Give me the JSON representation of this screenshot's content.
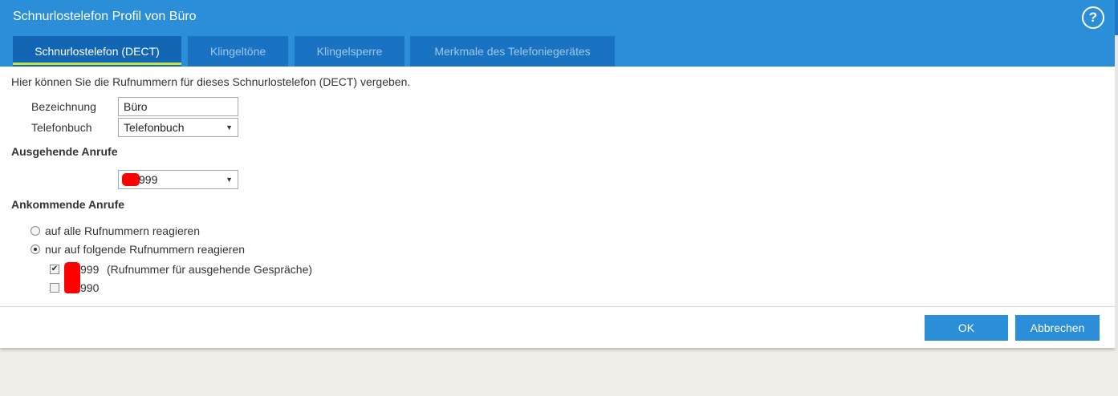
{
  "dialog": {
    "title": "Schnurlostelefon Profil von Büro",
    "help_icon": "help-icon"
  },
  "tabs": [
    {
      "label": "Schnurlostelefon (DECT)",
      "active": true
    },
    {
      "label": "Klingeltöne",
      "active": false
    },
    {
      "label": "Klingelsperre",
      "active": false
    },
    {
      "label": "Merkmale des Telefoniegerätes",
      "active": false
    }
  ],
  "intro": "Hier können Sie die Rufnummern für dieses Schnurlostelefon (DECT) vergeben.",
  "form": {
    "bezeichnung_label": "Bezeichnung",
    "bezeichnung_value": "Büro",
    "telefonbuch_label": "Telefonbuch",
    "telefonbuch_value": "Telefonbuch"
  },
  "outgoing": {
    "heading": "Ausgehende Anrufe",
    "selected_number": "999"
  },
  "incoming": {
    "heading": "Ankommende Anrufe",
    "radio_all": "auf alle Rufnummern reagieren",
    "radio_selected": "nur auf folgende Rufnummern reagieren",
    "numbers": [
      {
        "number": "999",
        "note": "(Rufnummer für ausgehende Gespräche)",
        "checked": true
      },
      {
        "number": "990",
        "note": "",
        "checked": false
      }
    ]
  },
  "buttons": {
    "ok": "OK",
    "cancel": "Abbrechen"
  },
  "colors": {
    "header": "#2b8ed8",
    "tab": "#1a73c2",
    "tab_active": "#1366b3",
    "tab_underline": "#c8e04a",
    "button": "#2b8ed8",
    "redaction": "#ff0000"
  }
}
